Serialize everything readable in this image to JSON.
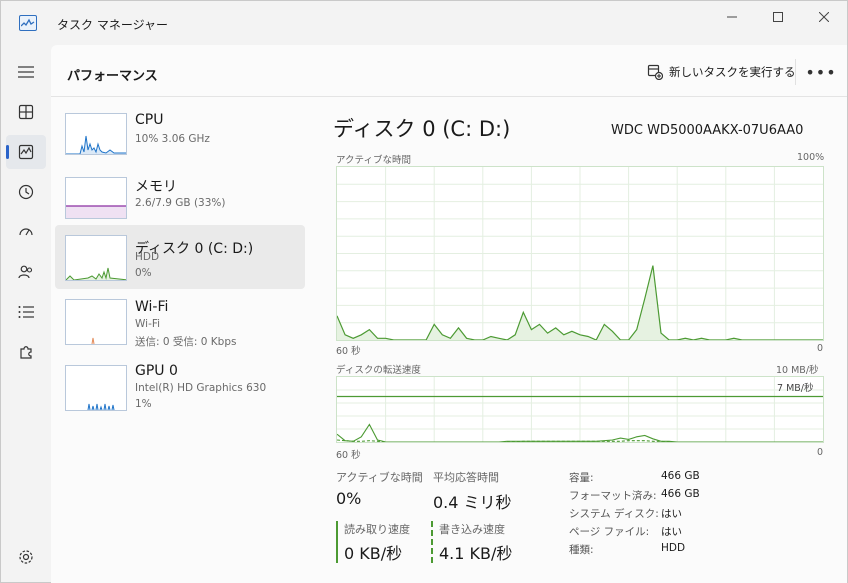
{
  "window": {
    "title": "タスク マネージャー"
  },
  "header": {
    "title": "パフォーマンス",
    "run_new_task": "新しいタスクを実行する",
    "more": "•••"
  },
  "colors": {
    "accent": "#2a63c9",
    "cpu": "#1f74c9",
    "memory": "#8b2fa1",
    "disk": "#4c9a33",
    "disk_fill": "#e6f2e1"
  },
  "devices": [
    {
      "name": "CPU",
      "sub1": "10%  3.06 GHz",
      "sub2": "",
      "sub3": ""
    },
    {
      "name": "メモリ",
      "sub1": "2.6/7.9 GB (33%)",
      "sub2": "",
      "sub3": ""
    },
    {
      "name": "ディスク 0 (C: D:)",
      "sub1": "HDD",
      "sub2": "0%",
      "sub3": ""
    },
    {
      "name": "Wi-Fi",
      "sub1": "Wi-Fi",
      "sub2": "送信: 0 受信: 0 Kbps",
      "sub3": ""
    },
    {
      "name": "GPU 0",
      "sub1": "Intel(R) HD Graphics 630",
      "sub2": "1%",
      "sub3": ""
    }
  ],
  "detail": {
    "title": "ディスク 0 (C: D:)",
    "model": "WDC WD5000AAKX-07U6AA0",
    "active_chart": {
      "label": "アクティブな時間",
      "max": "100%",
      "time": "60 秒",
      "min": "0"
    },
    "transfer_chart": {
      "label": "ディスクの転送速度",
      "max": "10 MB/秒",
      "line_label": "7 MB/秒",
      "time": "60 秒",
      "min": "0"
    },
    "stats": {
      "active_time": {
        "label": "アクティブな時間",
        "value": "0%"
      },
      "response": {
        "label": "平均応答時間",
        "value": "0.4 ミリ秒"
      },
      "read": {
        "label": "読み取り速度",
        "value": "0 KB/秒"
      },
      "write": {
        "label": "書き込み速度",
        "value": "4.1 KB/秒"
      }
    },
    "props": [
      {
        "key": "容量:",
        "value": "466 GB"
      },
      {
        "key": "フォーマット済み:",
        "value": "466 GB"
      },
      {
        "key": "システム ディスク:",
        "value": "はい"
      },
      {
        "key": "ページ ファイル:",
        "value": "はい"
      },
      {
        "key": "種類:",
        "value": "HDD"
      }
    ]
  },
  "chart_data": [
    {
      "type": "area",
      "title": "アクティブな時間",
      "ylim": [
        0,
        100
      ],
      "x": [
        60,
        59,
        58,
        57,
        56,
        55,
        54,
        53,
        52,
        51,
        50,
        49,
        48,
        47,
        46,
        45,
        44,
        43,
        42,
        41,
        40,
        39,
        38,
        37,
        36,
        35,
        34,
        33,
        32,
        31,
        30,
        29,
        28,
        27,
        26,
        25,
        24,
        23,
        22,
        21,
        20,
        19,
        18,
        17,
        16,
        15,
        14,
        13,
        12,
        11,
        10,
        9,
        8,
        7,
        6,
        5,
        4,
        3,
        2,
        1,
        0
      ],
      "values": [
        14,
        3,
        1,
        3,
        6,
        1,
        1,
        0,
        0,
        0,
        0,
        0,
        9,
        3,
        1,
        7,
        1,
        0,
        0,
        2,
        1,
        0,
        3,
        16,
        6,
        9,
        4,
        7,
        3,
        5,
        3,
        2,
        0,
        9,
        5,
        0,
        0,
        6,
        24,
        43,
        4,
        0,
        0,
        1,
        0,
        1,
        0,
        0,
        0,
        1,
        0,
        0,
        0,
        0,
        0,
        0,
        0,
        0,
        0,
        0,
        0
      ]
    },
    {
      "type": "line",
      "title": "ディスクの転送速度",
      "ylim": [
        0,
        10
      ],
      "reference_line": 7,
      "x": [
        60,
        59,
        58,
        57,
        56,
        55,
        54,
        53,
        52,
        51,
        50,
        49,
        48,
        47,
        46,
        45,
        44,
        43,
        42,
        41,
        40,
        39,
        38,
        37,
        36,
        35,
        34,
        33,
        32,
        31,
        30,
        29,
        28,
        27,
        26,
        25,
        24,
        23,
        22,
        21,
        20,
        19,
        18,
        17,
        16,
        15,
        14,
        13,
        12,
        11,
        10,
        9,
        8,
        7,
        6,
        5,
        4,
        3,
        2,
        1,
        0
      ],
      "series": [
        {
          "values": [
            1.2,
            0.2,
            0.1,
            0.8,
            2.7,
            0.3,
            0,
            0,
            0,
            0,
            0,
            0,
            0,
            0,
            0,
            0,
            0,
            0,
            0,
            0,
            0,
            0.1,
            0.1,
            0.1,
            0.1,
            0.1,
            0.1,
            0.1,
            0.1,
            0.1,
            0.1,
            0.1,
            0.1,
            0.2,
            0.3,
            0.6,
            0.4,
            0.8,
            1.0,
            0.5,
            0.1,
            0.1,
            0,
            0,
            0,
            0,
            0,
            0,
            0,
            0,
            0,
            0,
            0,
            0,
            0,
            0,
            0,
            0,
            0,
            0,
            0
          ]
        },
        {
          "values": [
            0.3,
            0.2,
            0.1,
            0.1,
            0.2,
            0.1,
            0,
            0,
            0,
            0,
            0,
            0,
            0,
            0,
            0,
            0,
            0,
            0,
            0,
            0,
            0,
            0,
            0,
            0.1,
            0.1,
            0.1,
            0.1,
            0.1,
            0.1,
            0.1,
            0.1,
            0.1,
            0.1,
            0.1,
            0.1,
            0.1,
            0.2,
            0.2,
            0.2,
            0.1,
            0.1,
            0,
            0,
            0,
            0,
            0,
            0,
            0,
            0,
            0,
            0,
            0,
            0,
            0,
            0,
            0,
            0,
            0,
            0,
            0,
            0
          ]
        }
      ]
    }
  ]
}
